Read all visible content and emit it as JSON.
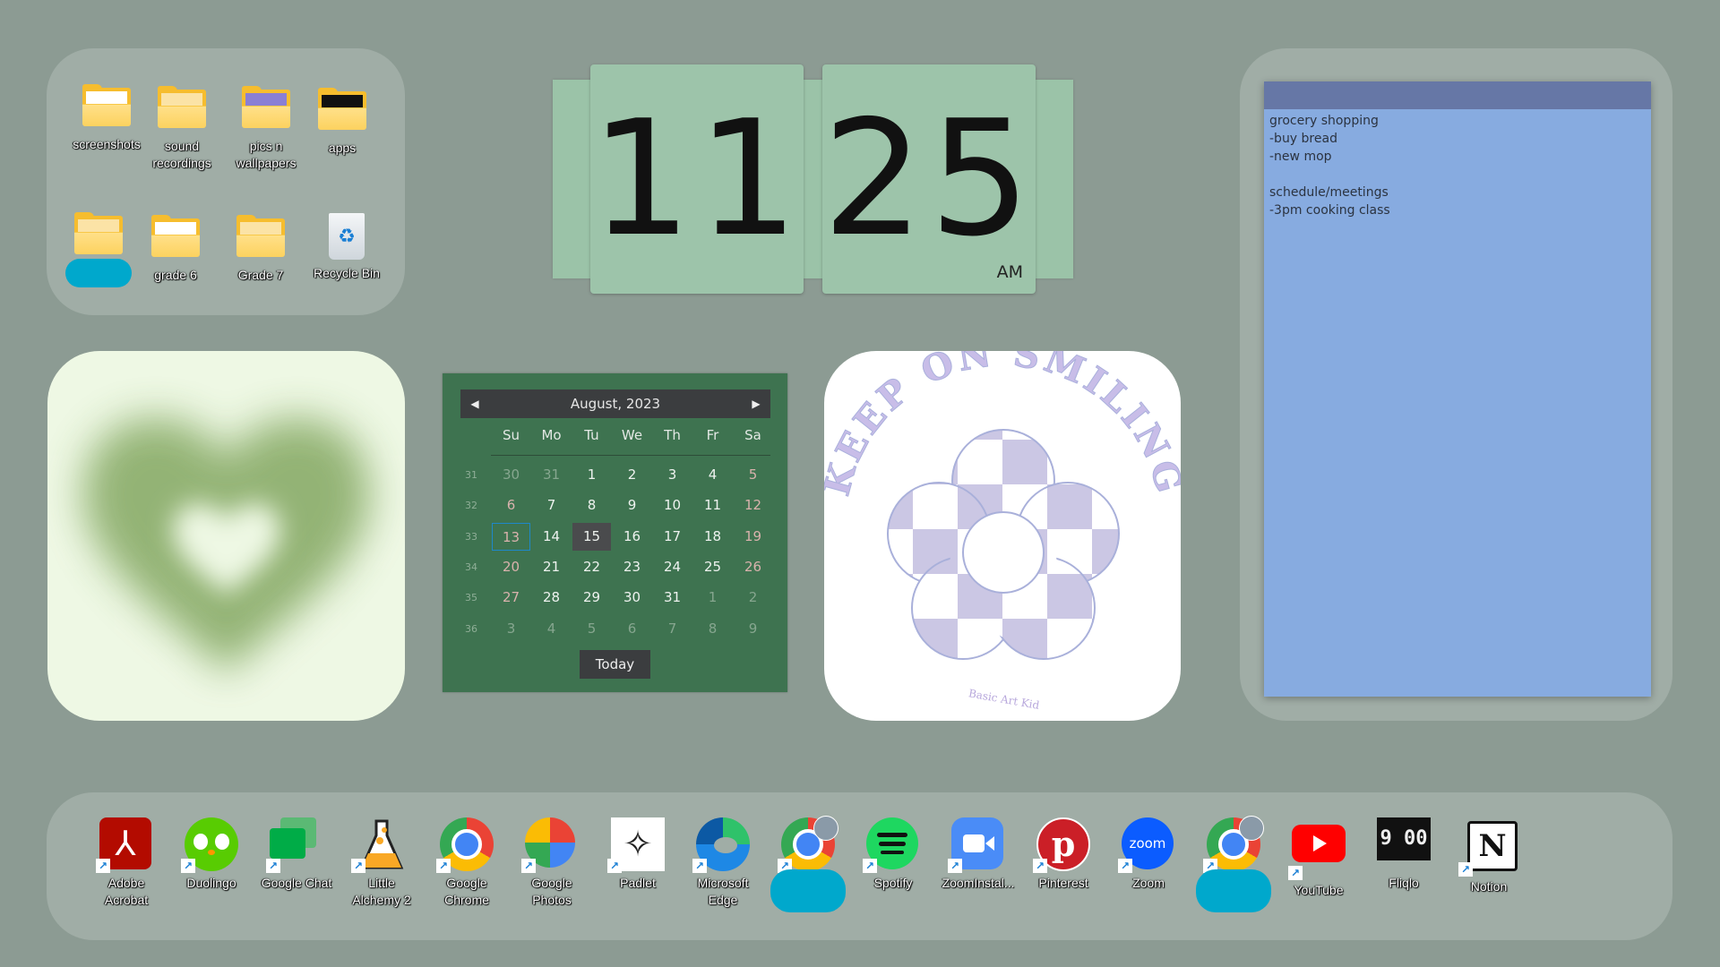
{
  "folders_widget": {
    "items": [
      {
        "label": "screenshots",
        "icon": "folder-icon"
      },
      {
        "label": "sound\nrecordings",
        "icon": "folder-icon"
      },
      {
        "label": "pics n\nwallpapers",
        "icon": "folder-icon"
      },
      {
        "label": "apps",
        "icon": "folder-icon"
      },
      {
        "label": "",
        "icon": "folder-icon",
        "redacted": true
      },
      {
        "label": "grade 6",
        "icon": "folder-icon"
      },
      {
        "label": "Grade 7",
        "icon": "folder-icon"
      },
      {
        "label": "Recycle Bin",
        "icon": "recycle-bin-icon"
      }
    ]
  },
  "clock": {
    "hours": "11",
    "minutes": "25",
    "ampm": "AM"
  },
  "calendar": {
    "title": "August, 2023",
    "prev_icon": "◀",
    "next_icon": "▶",
    "days_of_week": [
      "Su",
      "Mo",
      "Tu",
      "We",
      "Th",
      "Fr",
      "Sa"
    ],
    "week_numbers": [
      "31",
      "32",
      "33",
      "34",
      "35",
      "36"
    ],
    "weeks": [
      [
        "30",
        "31",
        "1",
        "2",
        "3",
        "4",
        "5"
      ],
      [
        "6",
        "7",
        "8",
        "9",
        "10",
        "11",
        "12"
      ],
      [
        "13",
        "14",
        "15",
        "16",
        "17",
        "18",
        "19"
      ],
      [
        "20",
        "21",
        "22",
        "23",
        "24",
        "25",
        "26"
      ],
      [
        "27",
        "28",
        "29",
        "30",
        "31",
        "1",
        "2"
      ],
      [
        "3",
        "4",
        "5",
        "6",
        "7",
        "8",
        "9"
      ]
    ],
    "selected_day": "15",
    "focused_day": "13",
    "today_label": "Today"
  },
  "image_widgets": {
    "heart": "green aura heart",
    "smile_text": "KEEP ON SMILING",
    "smile_credit": "Basic Art Kid"
  },
  "sticky_note": {
    "text": "grocery shopping\n-buy bread\n-new mop\n\nschedule/meetings\n-3pm cooking class",
    "colors": {
      "header": "#6677a6",
      "body": "#87abe0"
    }
  },
  "dock": {
    "apps": [
      {
        "label": "Adobe\nAcrobat",
        "icon": "adobe-acrobat-icon"
      },
      {
        "label": "Duolingo",
        "icon": "duolingo-icon"
      },
      {
        "label": "Google Chat",
        "icon": "google-chat-icon"
      },
      {
        "label": "Little\nAlchemy 2",
        "icon": "little-alchemy-icon"
      },
      {
        "label": "Google\nChrome",
        "icon": "chrome-icon"
      },
      {
        "label": "Google\nPhotos",
        "icon": "google-photos-icon"
      },
      {
        "label": "Padlet",
        "icon": "padlet-icon"
      },
      {
        "label": "Microsoft\nEdge",
        "icon": "edge-icon"
      },
      {
        "label": "",
        "icon": "chrome-profile-icon",
        "redacted": true
      },
      {
        "label": "Spotify",
        "icon": "spotify-icon"
      },
      {
        "label": "ZoomInstal...",
        "icon": "zoom-installer-icon"
      },
      {
        "label": "Pinterest",
        "icon": "pinterest-icon"
      },
      {
        "label": "Zoom",
        "icon": "zoom-icon"
      },
      {
        "label": "",
        "icon": "chrome-profile-icon",
        "redacted": true
      },
      {
        "label": "YouTube",
        "icon": "youtube-icon"
      },
      {
        "label": "Fliqlo",
        "icon": "fliqlo-icon"
      },
      {
        "label": "Notion",
        "icon": "notion-icon"
      }
    ],
    "zoom_text": "zoom",
    "fliqlo_text": "9 00"
  },
  "colors": {
    "desktop": "#8c9b93",
    "panel": "#a0ada6",
    "calendar": "#3e7350",
    "clock": "#9dc4aa"
  }
}
